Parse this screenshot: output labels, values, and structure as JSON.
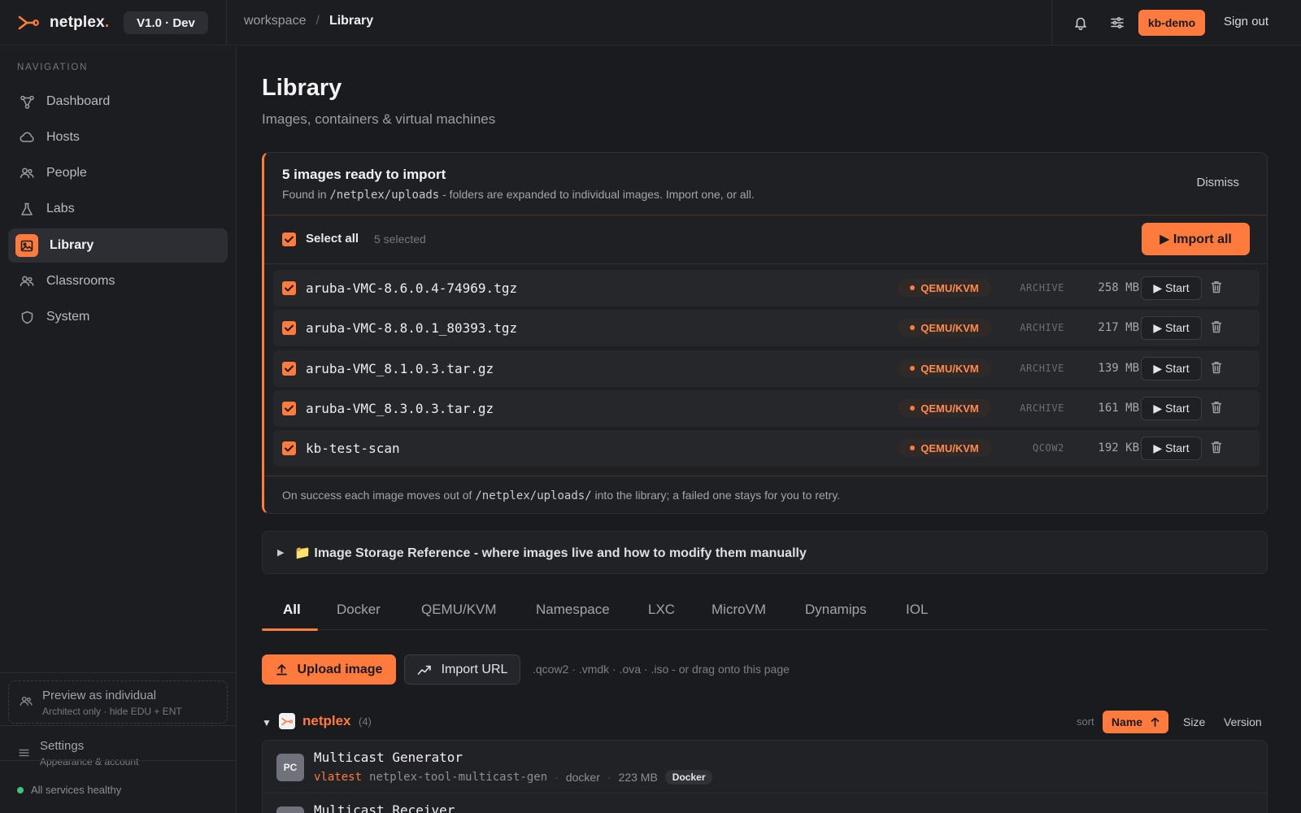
{
  "brand": {
    "name": "netplex",
    "dot": ".",
    "version": "V1.0 · Dev"
  },
  "breadcrumb": {
    "root": "workspace",
    "separator": "/",
    "current": "Library"
  },
  "topbar": {
    "user": "kb-demo",
    "sign_out": "Sign out",
    "icons": [
      "bell-icon",
      "sliders-icon"
    ]
  },
  "sidebar": {
    "heading": "NAVIGATION",
    "items": [
      {
        "label": "Dashboard",
        "icon": "graph-nodes-icon"
      },
      {
        "label": "Hosts",
        "icon": "cloud-icon"
      },
      {
        "label": "People",
        "icon": "people-icon"
      },
      {
        "label": "Labs",
        "icon": "flask-icon"
      },
      {
        "label": "Library",
        "icon": "image-icon",
        "active": true
      },
      {
        "label": "Classrooms",
        "icon": "people-icon"
      },
      {
        "label": "System",
        "icon": "shield-icon"
      }
    ],
    "preview": {
      "title": "Preview as individual",
      "subtitle": "Architect only · hide EDU + ENT"
    },
    "settings": {
      "title": "Settings",
      "subtitle": "Appearance & account"
    },
    "health": "All services healthy",
    "health_color": "#3fc47a"
  },
  "page": {
    "title": "Library",
    "subtitle": "Images, containers & virtual machines"
  },
  "import_card": {
    "title": "5 images ready to import",
    "desc_prefix": "Found in",
    "desc_path": "/netplex/uploads",
    "desc_suffix": "- folders are expanded to individual images. Import one, or all.",
    "dismiss": "Dismiss",
    "select_all": "Select all",
    "selected_count": "5 selected",
    "import_all": "▶ Import all",
    "rows": [
      {
        "name": "aruba-VMC-8.6.0.4-74969.tgz",
        "engine": "QEMU/KVM",
        "kind": "ARCHIVE",
        "size": "258 MB",
        "action": "▶ Start",
        "checked": true
      },
      {
        "name": "aruba-VMC-8.8.0.1_80393.tgz",
        "engine": "QEMU/KVM",
        "kind": "ARCHIVE",
        "size": "217 MB",
        "action": "▶ Start",
        "checked": true
      },
      {
        "name": "aruba-VMC_8.1.0.3.tar.gz",
        "engine": "QEMU/KVM",
        "kind": "ARCHIVE",
        "size": "139 MB",
        "action": "▶ Start",
        "checked": true
      },
      {
        "name": "aruba-VMC_8.3.0.3.tar.gz",
        "engine": "QEMU/KVM",
        "kind": "ARCHIVE",
        "size": "161 MB",
        "action": "▶ Start",
        "checked": true
      },
      {
        "name": "kb-test-scan",
        "engine": "QEMU/KVM",
        "kind": "QCOW2",
        "size": "192 KB",
        "action": "▶ Start",
        "checked": true
      }
    ],
    "foot_prefix": "On success each image moves out of",
    "foot_path": "/netplex/uploads/",
    "foot_suffix": "into the library; a failed one stays for you to retry."
  },
  "storage_ref": {
    "caret": "▶",
    "label": "📁 Image Storage Reference - where images live and how to modify them manually"
  },
  "tabs": [
    {
      "label": "All",
      "active": true
    },
    {
      "label": "Docker"
    },
    {
      "label": "QEMU/KVM"
    },
    {
      "label": "Namespace"
    },
    {
      "label": "LXC"
    },
    {
      "label": "MicroVM"
    },
    {
      "label": "Dynamips"
    },
    {
      "label": "IOL"
    }
  ],
  "upload": {
    "upload_label": "Upload image",
    "url_label": "Import URL",
    "hint": ".qcow2 · .vmdk · .ova · .iso - or drag onto this page"
  },
  "group": {
    "name": "netplex",
    "count": "(4)",
    "sort_label": "sort",
    "sort_active": "Name",
    "sort_options": [
      "Size",
      "Version"
    ]
  },
  "library_items": [
    {
      "initials": "PC",
      "name": "Multicast Generator",
      "version": "vlatest",
      "image": "netplex-tool-multicast-gen",
      "runtime": "docker",
      "size": "223 MB",
      "type": "Docker"
    },
    {
      "initials": "",
      "name": "Multicast Receiver",
      "version": "",
      "image": "",
      "runtime": "",
      "size": "",
      "type": ""
    }
  ],
  "colors": {
    "accent": "#ff7a3d",
    "background": "#1a1b1e",
    "surface": "#1f2024"
  }
}
